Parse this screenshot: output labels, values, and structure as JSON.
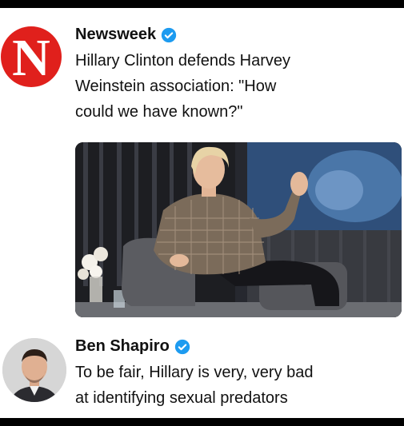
{
  "tweets": [
    {
      "display_name": "Newsweek",
      "avatar_letter": "N",
      "avatar_color": "#e0201c",
      "verified_icon": "verified-badge-icon",
      "text": "Hillary Clinton defends Harvey\nWeinstein association: \"How\ncould we have known?\""
    },
    {
      "display_name": "Ben Shapiro",
      "verified_icon": "verified-badge-icon",
      "text": "To be fair, Hillary is very, very bad\nat identifying sexual predators"
    }
  ],
  "colors": {
    "verified_blue": "#1d9bf0",
    "text": "#111111",
    "border": "#000000"
  }
}
